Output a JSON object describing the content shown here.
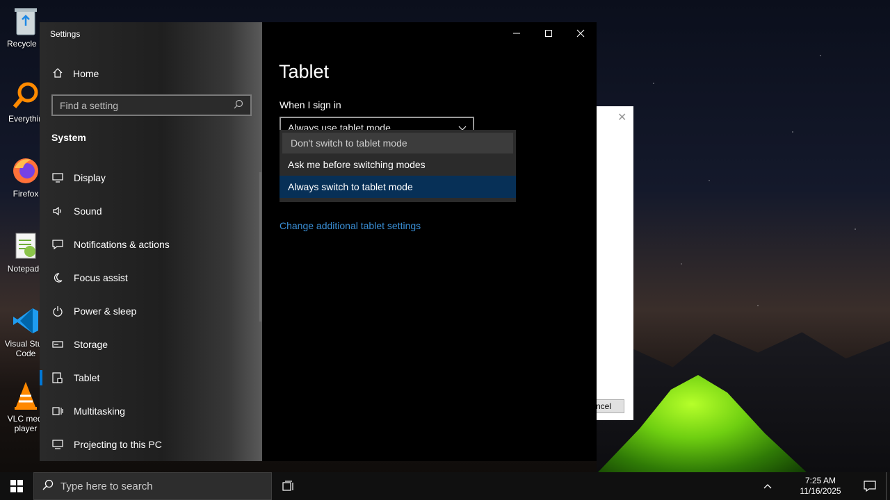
{
  "desktop": {
    "icons": [
      {
        "label": "Recycle B",
        "icon": "recycle-bin-icon"
      },
      {
        "label": "Everythin",
        "icon": "everything-search-icon"
      },
      {
        "label": "Firefox",
        "icon": "firefox-icon"
      },
      {
        "label": "Notepad+",
        "icon": "notepad-plus-plus-icon"
      },
      {
        "label": "Visual Studio Code",
        "line1": "Visual Stud",
        "line2": "Code",
        "icon": "vscode-icon"
      },
      {
        "label": "VLC media player",
        "line1": "VLC medi",
        "line2": "player",
        "icon": "vlc-icon"
      }
    ]
  },
  "background_dialog": {
    "cancel_label": "ncel"
  },
  "settings": {
    "window_title": "Settings",
    "home_label": "Home",
    "search_placeholder": "Find a setting",
    "section_title": "System",
    "nav_items": [
      {
        "label": "Display",
        "icon": "monitor-icon"
      },
      {
        "label": "Sound",
        "icon": "speaker-icon"
      },
      {
        "label": "Notifications & actions",
        "icon": "notification-icon"
      },
      {
        "label": "Focus assist",
        "icon": "moon-icon"
      },
      {
        "label": "Power & sleep",
        "icon": "power-icon"
      },
      {
        "label": "Storage",
        "icon": "storage-icon"
      },
      {
        "label": "Tablet",
        "icon": "tablet-icon",
        "active": true
      },
      {
        "label": "Multitasking",
        "icon": "multitasking-icon"
      },
      {
        "label": "Projecting to this PC",
        "icon": "projector-icon"
      }
    ],
    "page_title": "Tablet",
    "sign_in_label": "When I sign in",
    "select_value": "Always use tablet mode",
    "dropdown_options": [
      "Don't switch to tablet mode",
      "Ask me before switching modes",
      "Always switch to tablet mode"
    ],
    "link_label": "Change additional tablet settings"
  },
  "taskbar": {
    "search_placeholder": "Type here to search",
    "time": "7:25 AM",
    "date": "11/16/2025"
  },
  "colors": {
    "accent": "#0078d7",
    "link": "#3a8fd6",
    "selected_option": "#073057"
  }
}
